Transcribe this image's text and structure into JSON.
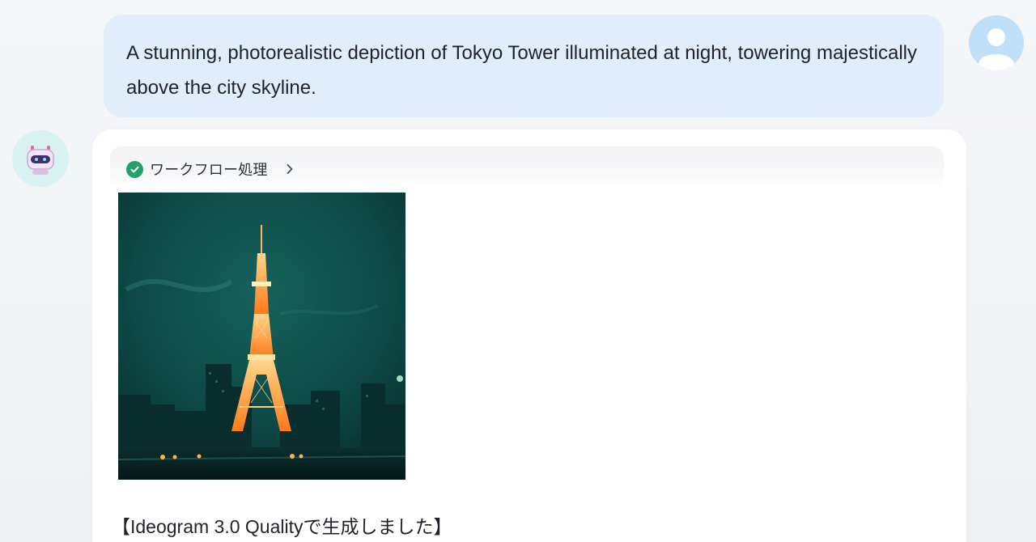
{
  "user_message": {
    "text": "A stunning, photorealistic depiction of Tokyo Tower illuminated at night, towering majestically above the city skyline."
  },
  "bot_message": {
    "workflow_label": "ワークフロー処理",
    "workflow_status": "completed",
    "image_subject": "Tokyo Tower illuminated at night",
    "caption": "【Ideogram 3.0 Qualityで生成しました】"
  },
  "icons": {
    "user_avatar": "user-avatar-icon",
    "bot_avatar": "robot-avatar-icon",
    "check": "check-circle-icon",
    "chevron": "chevron-right-icon"
  },
  "colors": {
    "user_bubble": "#dfedfd",
    "check": "#23a16b",
    "tower_light": "#ff9a2a"
  }
}
